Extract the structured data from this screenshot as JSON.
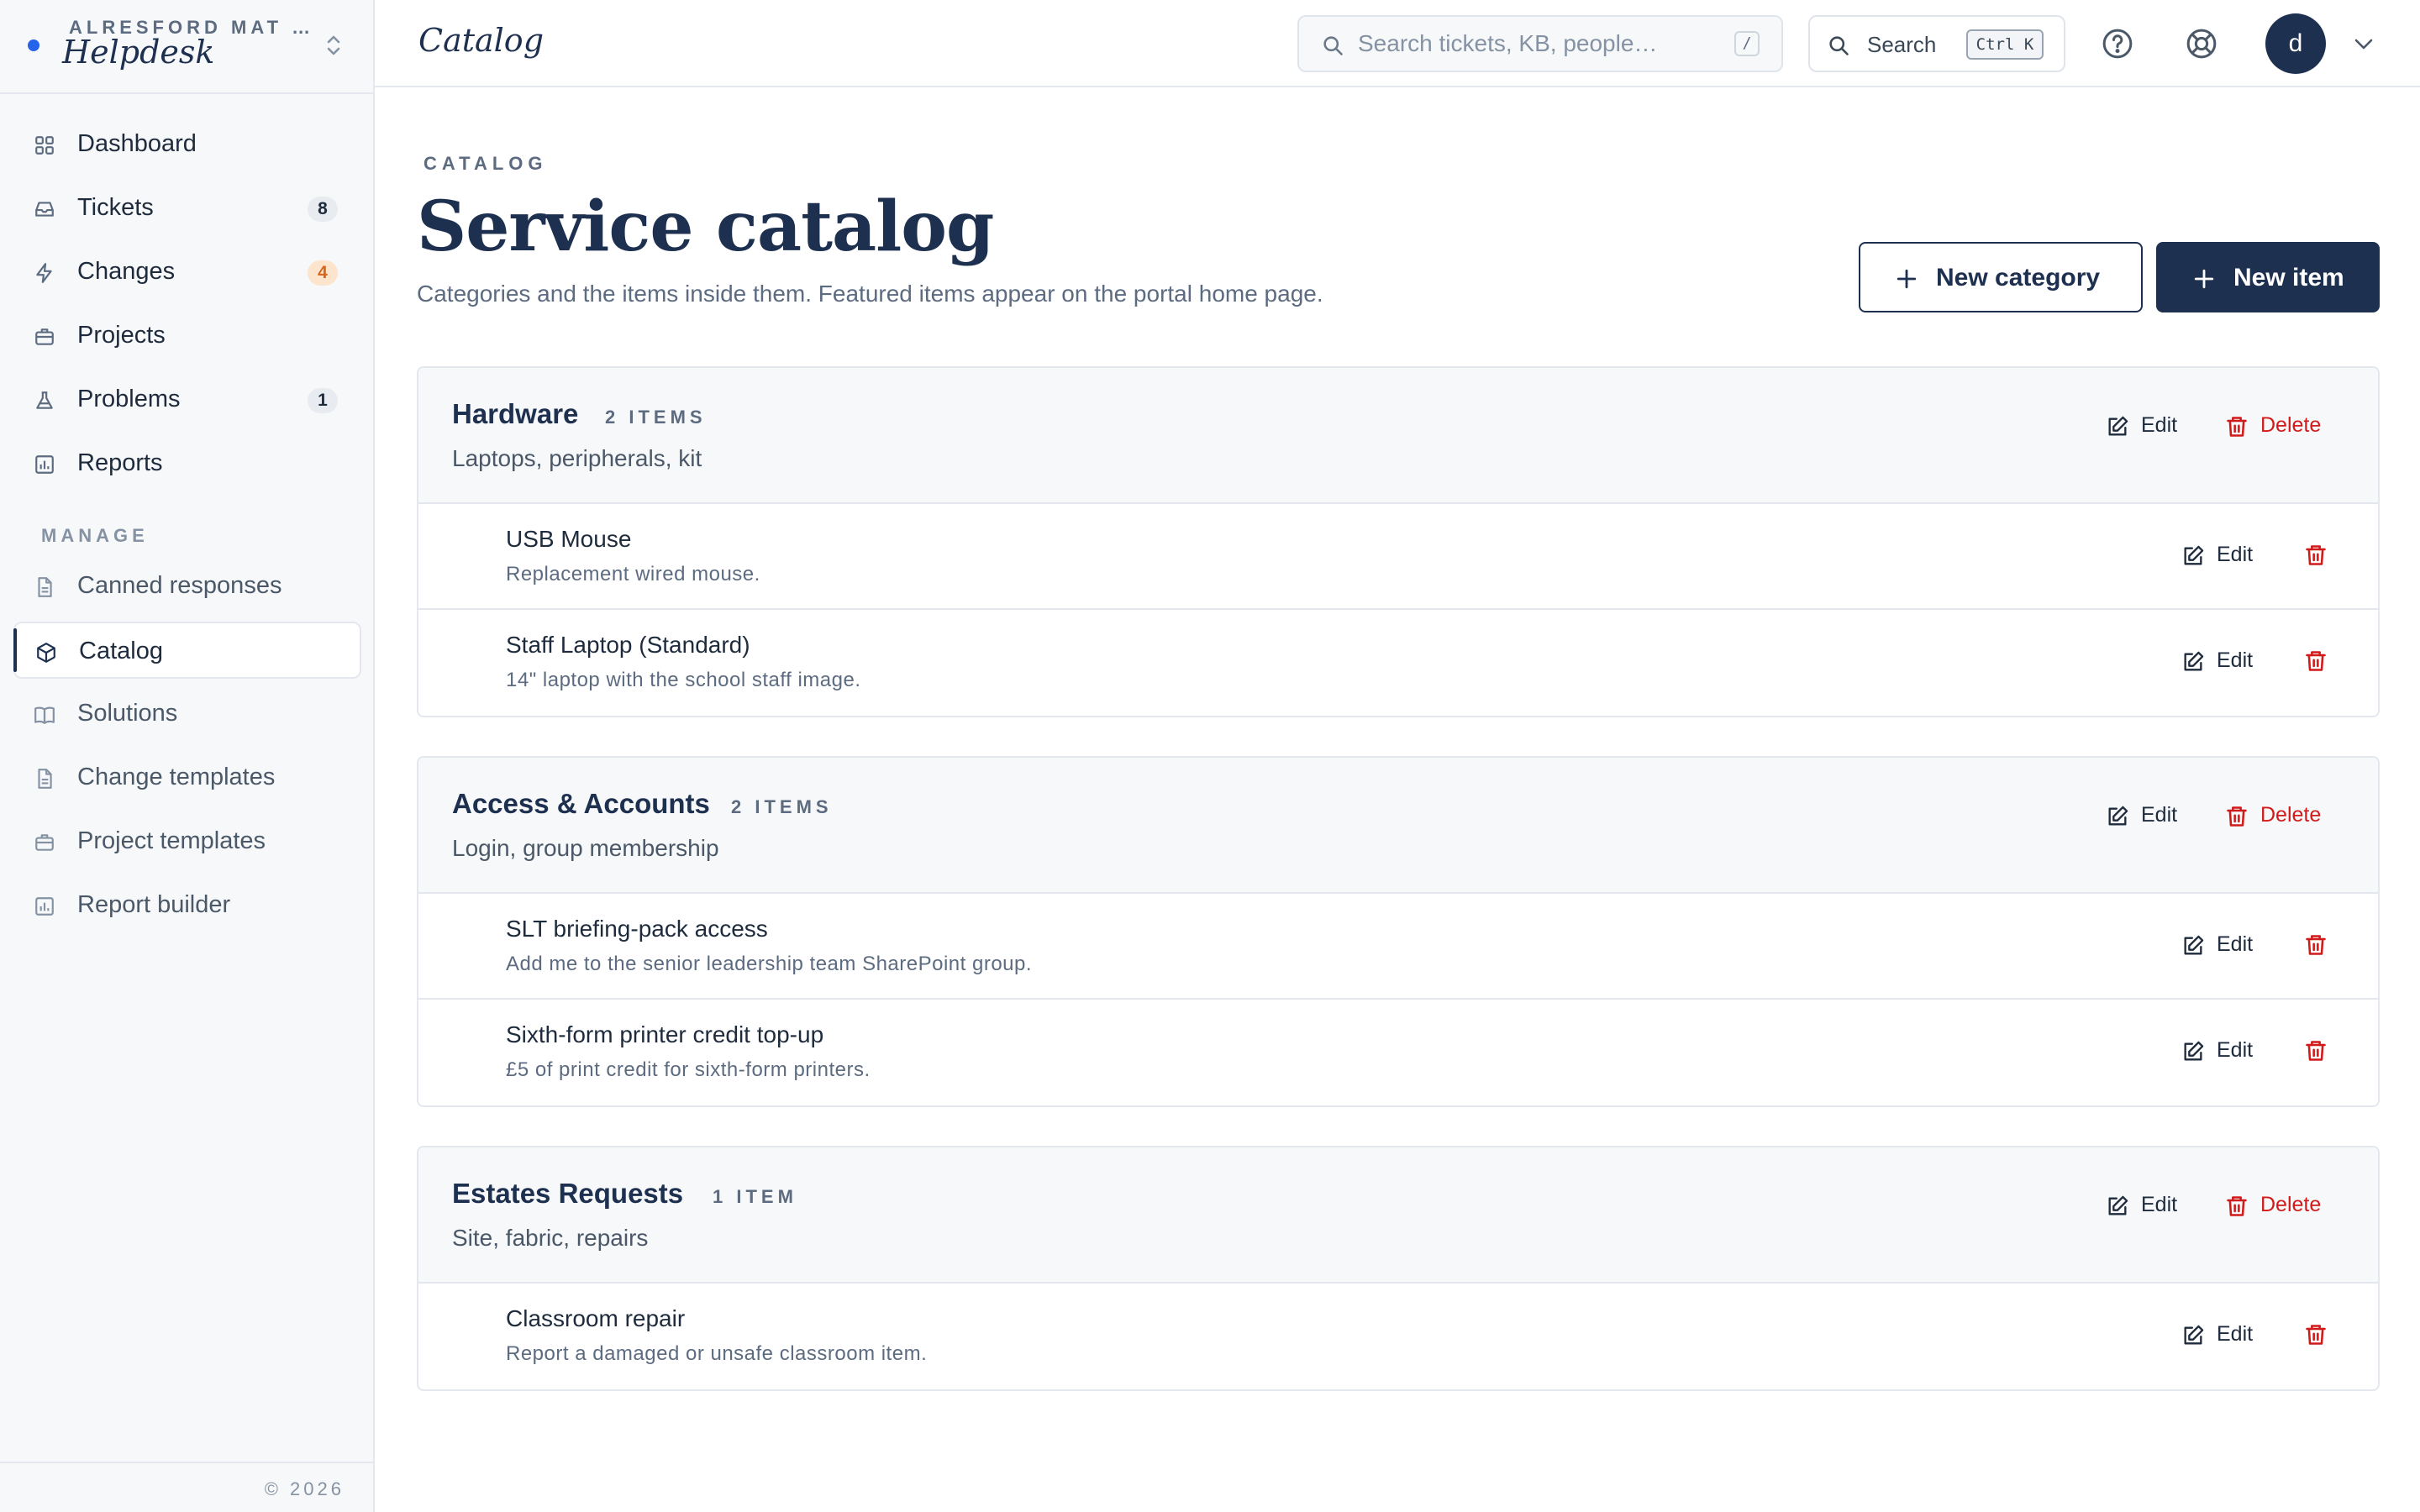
{
  "sidebar": {
    "org": "ALRESFORD MAT …",
    "app": "Helpdesk",
    "nav": [
      {
        "label": "Dashboard",
        "icon": "grid-icon"
      },
      {
        "label": "Tickets",
        "icon": "inbox-icon",
        "badge": "8"
      },
      {
        "label": "Changes",
        "icon": "lightning-icon",
        "badge": "4"
      },
      {
        "label": "Projects",
        "icon": "briefcase-icon"
      },
      {
        "label": "Problems",
        "icon": "flask-icon",
        "badge": "1"
      },
      {
        "label": "Reports",
        "icon": "chart-icon"
      }
    ],
    "manage_label": "MANAGE",
    "manage": [
      {
        "label": "Canned responses",
        "icon": "document-icon"
      },
      {
        "label": "Catalog",
        "icon": "cube-icon",
        "active": true
      },
      {
        "label": "Solutions",
        "icon": "book-icon"
      },
      {
        "label": "Change templates",
        "icon": "document-icon"
      },
      {
        "label": "Project templates",
        "icon": "briefcase-icon"
      },
      {
        "label": "Report builder",
        "icon": "chart-icon"
      }
    ],
    "footer": "© 2026"
  },
  "topbar": {
    "title": "Catalog",
    "search_placeholder": "Search tickets, KB, people…",
    "search_shortcut": "/",
    "cmd_label": "Search",
    "cmd_shortcut": "Ctrl K",
    "avatar_initial": "d"
  },
  "page": {
    "eyebrow": "CATALOG",
    "title": "Service catalog",
    "subtitle": "Categories and the items inside them. Featured items appear on the portal home page.",
    "new_category_label": "New category",
    "new_item_label": "New item",
    "edit_label": "Edit",
    "delete_label": "Delete"
  },
  "categories": [
    {
      "name": "Hardware",
      "count": "2 ITEMS",
      "description": "Laptops, peripherals, kit",
      "items": [
        {
          "name": "USB Mouse",
          "description": "Replacement wired mouse."
        },
        {
          "name": "Staff Laptop (Standard)",
          "description": "14\" laptop with the school staff image."
        }
      ]
    },
    {
      "name": "Access & Accounts",
      "count": "2 ITEMS",
      "description": "Login, group membership",
      "items": [
        {
          "name": "SLT briefing-pack access",
          "description": "Add me to the senior leadership team SharePoint group."
        },
        {
          "name": "Sixth-form printer credit top-up",
          "description": "£5 of print credit for sixth-form printers."
        }
      ]
    },
    {
      "name": "Estates Requests",
      "count": "1 ITEM",
      "description": "Site, fabric, repairs",
      "items": [
        {
          "name": "Classroom repair",
          "description": "Report a damaged or unsafe classroom item."
        }
      ]
    }
  ],
  "colors": {
    "navy": "#1e3050",
    "danger": "#d11a1a",
    "accent_dot": "#2563eb",
    "warn_badge": "#d9651a"
  }
}
